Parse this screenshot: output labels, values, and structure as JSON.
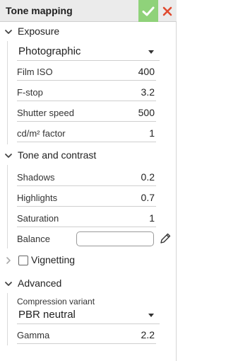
{
  "header": {
    "title": "Tone mapping",
    "accept_icon": "check-icon",
    "close_icon": "close-icon"
  },
  "colors": {
    "accept_bg": "#8fd27a",
    "close": "#e04a2f"
  },
  "exposure": {
    "title": "Exposure",
    "mode": "Photographic",
    "film_iso": {
      "label": "Film ISO",
      "value": "400"
    },
    "f_stop": {
      "label": "F-stop",
      "value": "3.2"
    },
    "shutter_speed": {
      "label": "Shutter speed",
      "value": "500"
    },
    "cdm2_factor": {
      "label": "cd/m² factor",
      "value": "1"
    }
  },
  "tone": {
    "title": "Tone and contrast",
    "shadows": {
      "label": "Shadows",
      "value": "0.2"
    },
    "highlights": {
      "label": "Highlights",
      "value": "0.7"
    },
    "saturation": {
      "label": "Saturation",
      "value": "1"
    },
    "balance": {
      "label": "Balance"
    }
  },
  "vignetting": {
    "title": "Vignetting",
    "checked": false
  },
  "advanced": {
    "title": "Advanced",
    "compression_label": "Compression variant",
    "compression_value": "PBR neutral",
    "gamma": {
      "label": "Gamma",
      "value": "2.2"
    }
  }
}
